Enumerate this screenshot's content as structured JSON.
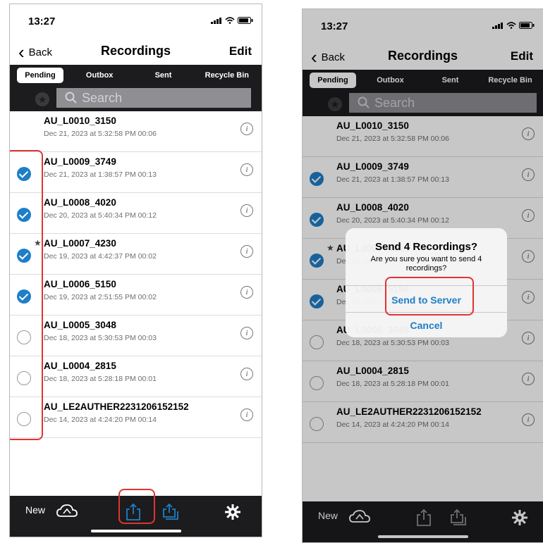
{
  "status": {
    "time": "13:27"
  },
  "nav": {
    "back_label": "Back",
    "title": "Recordings",
    "edit_label": "Edit"
  },
  "segments": [
    "Pending",
    "Outbox",
    "Sent",
    "Recycle Bin"
  ],
  "search": {
    "placeholder": "Search"
  },
  "recordings": [
    {
      "title": "AU_L0010_3150",
      "subtitle": "Dec 21, 2023 at 5:32:58 PM  00:06",
      "checked": false,
      "starred": false
    },
    {
      "title": "AU_L0009_3749",
      "subtitle": "Dec 21, 2023 at 1:38:57 PM  00:13",
      "checked": true,
      "starred": false
    },
    {
      "title": "AU_L0008_4020",
      "subtitle": "Dec 20, 2023 at 5:40:34 PM  00:12",
      "checked": true,
      "starred": false
    },
    {
      "title": "AU_L0007_4230",
      "subtitle": "Dec 19, 2023 at 4:42:37 PM  00:02",
      "checked": true,
      "starred": true
    },
    {
      "title": "AU_L0006_5150",
      "subtitle": "Dec 19, 2023 at 2:51:55 PM  00:02",
      "checked": true,
      "starred": false
    },
    {
      "title": "AU_L0005_3048",
      "subtitle": "Dec 18, 2023 at 5:30:53 PM  00:03",
      "checked": false,
      "starred": false
    },
    {
      "title": "AU_L0004_2815",
      "subtitle": "Dec 18, 2023 at 5:28:18 PM  00:01",
      "checked": false,
      "starred": false
    },
    {
      "title": "AU_LE2AUTHER2231206152152",
      "subtitle": "Dec 14, 2023 at 4:24:20 PM  00:14",
      "checked": false,
      "starred": false
    }
  ],
  "bottom": {
    "new_label": "New"
  },
  "dialog": {
    "title": "Send 4 Recordings?",
    "message": "Are you sure you want to send 4 recordings?",
    "confirm_label": "Send to Server",
    "cancel_label": "Cancel"
  },
  "colors": {
    "accent": "#1e7ec8",
    "highlight": "#e23333",
    "bar": "#1c1c1e"
  }
}
